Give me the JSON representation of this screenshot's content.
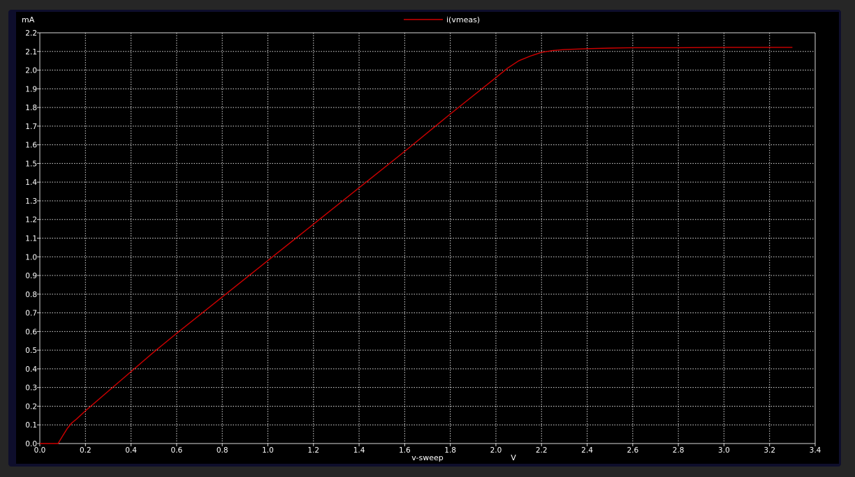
{
  "chart_data": {
    "type": "line",
    "title": "",
    "xlabel": "v-sweep",
    "xunit": "V",
    "yunit": "mA",
    "xlim": [
      0.0,
      3.4
    ],
    "ylim": [
      0.0,
      2.2
    ],
    "xticks": [
      "0.0",
      "0.2",
      "0.4",
      "0.6",
      "0.8",
      "1.0",
      "1.2",
      "1.4",
      "1.6",
      "1.8",
      "2.0",
      "2.2",
      "2.4",
      "2.6",
      "2.8",
      "3.0",
      "3.2",
      "3.4"
    ],
    "yticks": [
      "0.0",
      "0.1",
      "0.2",
      "0.3",
      "0.4",
      "0.5",
      "0.6",
      "0.7",
      "0.8",
      "0.9",
      "1.0",
      "1.1",
      "1.2",
      "1.3",
      "1.4",
      "1.5",
      "1.6",
      "1.7",
      "1.8",
      "1.9",
      "2.0",
      "2.1",
      "2.2"
    ],
    "grid": true,
    "legend_position": "top-center",
    "colors": {
      "background": "#000000",
      "grid": "#d9d9d9",
      "text": "#ffffff",
      "series": "#d00000"
    },
    "series": [
      {
        "name": "i(vmeas)",
        "x": [
          0.0,
          0.08,
          0.1,
          0.12,
          0.14,
          0.16,
          0.2,
          0.3,
          0.4,
          0.5,
          0.6,
          0.8,
          1.0,
          1.2,
          1.4,
          1.6,
          1.8,
          2.0,
          2.05,
          2.1,
          2.15,
          2.2,
          2.25,
          2.3,
          2.4,
          2.5,
          2.6,
          2.8,
          3.0,
          3.2,
          3.3
        ],
        "y": [
          0.0,
          0.0,
          0.04,
          0.08,
          0.11,
          0.13,
          0.175,
          0.28,
          0.385,
          0.49,
          0.59,
          0.785,
          0.98,
          1.175,
          1.37,
          1.565,
          1.765,
          1.96,
          2.01,
          2.05,
          2.075,
          2.095,
          2.105,
          2.11,
          2.115,
          2.118,
          2.12,
          2.12,
          2.122,
          2.122,
          2.122
        ]
      }
    ]
  }
}
